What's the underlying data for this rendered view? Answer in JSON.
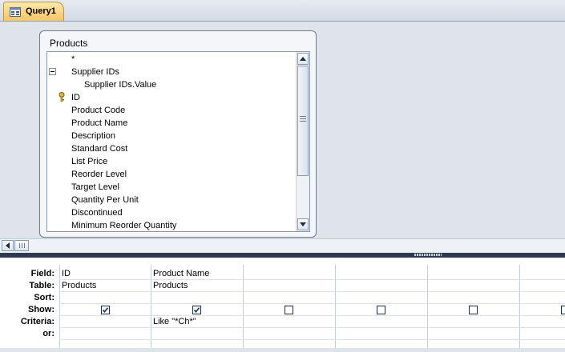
{
  "tab": {
    "title": "Query1"
  },
  "field_list": {
    "title": "Products",
    "items": [
      {
        "label": "*",
        "indent": 0
      },
      {
        "label": "Supplier IDs",
        "indent": 0,
        "collapse": "-"
      },
      {
        "label": "Supplier IDs.Value",
        "indent": 1
      },
      {
        "label": "ID",
        "indent": 0,
        "key": true
      },
      {
        "label": "Product Code",
        "indent": 0
      },
      {
        "label": "Product Name",
        "indent": 0
      },
      {
        "label": "Description",
        "indent": 0
      },
      {
        "label": "Standard Cost",
        "indent": 0
      },
      {
        "label": "List Price",
        "indent": 0
      },
      {
        "label": "Reorder Level",
        "indent": 0
      },
      {
        "label": "Target Level",
        "indent": 0
      },
      {
        "label": "Quantity Per Unit",
        "indent": 0
      },
      {
        "label": "Discontinued",
        "indent": 0
      },
      {
        "label": "Minimum Reorder Quantity",
        "indent": 0
      }
    ]
  },
  "grid": {
    "row_labels": [
      "Field:",
      "Table:",
      "Sort:",
      "Show:",
      "Criteria:",
      "or:"
    ],
    "columns": [
      {
        "field": "ID",
        "table": "Products",
        "sort": "",
        "show": true,
        "criteria": "",
        "or": ""
      },
      {
        "field": "Product Name",
        "table": "Products",
        "sort": "",
        "show": true,
        "criteria": "Like \"*Ch*\"",
        "or": ""
      },
      {
        "field": "",
        "table": "",
        "sort": "",
        "show": false,
        "criteria": "",
        "or": ""
      },
      {
        "field": "",
        "table": "",
        "sort": "",
        "show": false,
        "criteria": "",
        "or": ""
      },
      {
        "field": "",
        "table": "",
        "sort": "",
        "show": false,
        "criteria": "",
        "or": ""
      },
      {
        "field": "",
        "table": "",
        "sort": "",
        "show": false,
        "criteria": "",
        "or": ""
      }
    ]
  },
  "icons": {
    "tab": "query-icon",
    "key": "primary-key-icon",
    "collapse": "collapse-minus-icon"
  },
  "colors": {
    "tab_active": "#f8c561",
    "splitter": "#2b3a4e",
    "pane_bg": "#dfe3ea"
  }
}
